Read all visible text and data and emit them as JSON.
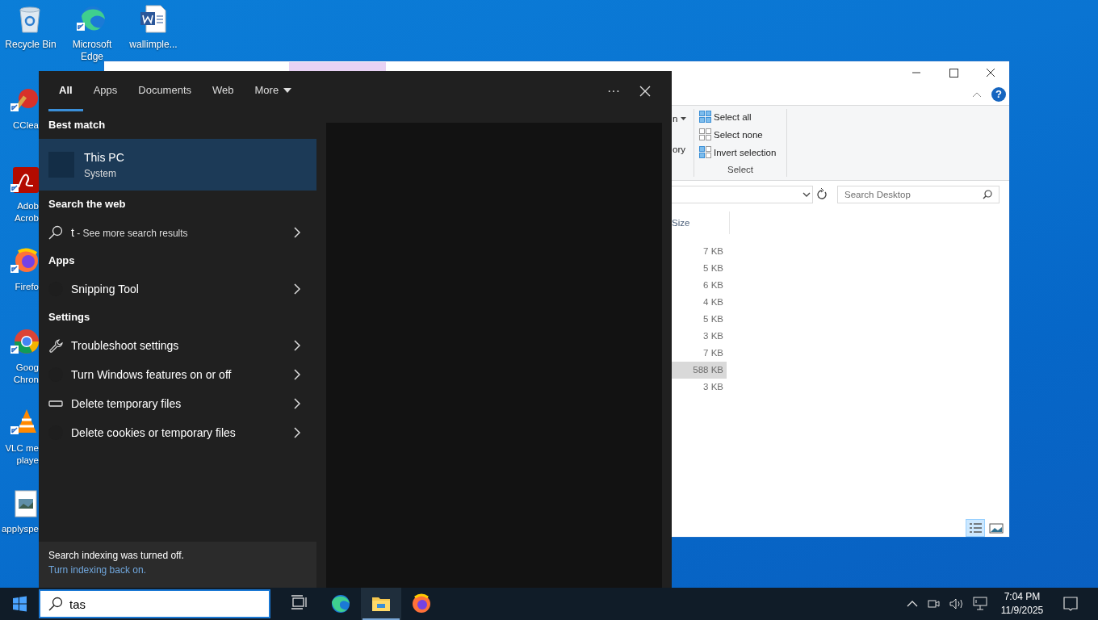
{
  "desktop": {
    "columns": [
      [
        {
          "label": "Recycle Bin",
          "kind": "recycle"
        },
        {
          "label": "CClea",
          "kind": "ccleaner"
        },
        {
          "label": "Adob Acrob",
          "kind": "acrobat"
        },
        {
          "label": "Firefo",
          "kind": "firefox"
        },
        {
          "label": "Goog Chron",
          "kind": "chrome"
        },
        {
          "label": "VLC me playe",
          "kind": "vlc"
        },
        {
          "label": "applyspe",
          "kind": "image"
        }
      ],
      [
        {
          "label": "Microsoft Edge",
          "kind": "edge"
        }
      ],
      [
        {
          "label": "wallimple...",
          "kind": "word"
        }
      ]
    ]
  },
  "explorer": {
    "help_button": "?",
    "ribbon_partial": [
      {
        "label": "n",
        "dropdown": true
      },
      {
        "label": "ory",
        "dropdown": false
      }
    ],
    "select_group": {
      "label": "Select",
      "items": [
        {
          "label": "Select all",
          "kind": "all"
        },
        {
          "label": "Select none",
          "kind": "none"
        },
        {
          "label": "Invert selection",
          "kind": "invert"
        }
      ]
    },
    "search": {
      "placeholder": "Search Desktop"
    },
    "columns": [
      "Size"
    ],
    "rows": [
      {
        "size": "7 KB",
        "selected": false
      },
      {
        "size": "5 KB",
        "selected": false
      },
      {
        "size": "6 KB",
        "selected": false
      },
      {
        "size": "4 KB",
        "selected": false
      },
      {
        "size": "5 KB",
        "selected": false
      },
      {
        "size": "3 KB",
        "selected": false
      },
      {
        "size": "7 KB",
        "selected": false
      },
      {
        "size": "588 KB",
        "selected": true
      },
      {
        "size": "3 KB",
        "selected": false
      }
    ],
    "views": [
      {
        "kind": "details",
        "selected": true
      },
      {
        "kind": "large",
        "selected": false
      }
    ]
  },
  "search_panel": {
    "tabs": [
      {
        "label": "All",
        "selected": true,
        "dropdown": false
      },
      {
        "label": "Apps",
        "selected": false,
        "dropdown": false
      },
      {
        "label": "Documents",
        "selected": false,
        "dropdown": false
      },
      {
        "label": "Web",
        "selected": false,
        "dropdown": false
      },
      {
        "label": "More",
        "selected": false,
        "dropdown": true
      }
    ],
    "more_button": "···",
    "sections": [
      {
        "heading": "Best match",
        "kind": "best",
        "items": [
          {
            "title": "This PC",
            "subtitle": "System",
            "selected": true
          }
        ]
      },
      {
        "heading": "Search the web",
        "kind": "list",
        "items": [
          {
            "title": "t",
            "detail": "- See more search results",
            "kind": "search",
            "selected": false
          }
        ]
      },
      {
        "heading": "Apps",
        "kind": "list",
        "items": [
          {
            "title": "Snipping Tool",
            "kind": "blank",
            "selected": false
          }
        ]
      },
      {
        "heading": "Settings",
        "kind": "list",
        "items": [
          {
            "title": "Troubleshoot settings",
            "kind": "wrench",
            "selected": false
          },
          {
            "title": "Turn Windows features on or off",
            "kind": "blank",
            "selected": false
          },
          {
            "title": "Delete temporary files",
            "kind": "drive",
            "selected": false
          },
          {
            "title": "Delete cookies or temporary files",
            "kind": "blank",
            "selected": false
          }
        ]
      }
    ],
    "footer": {
      "message": "Search indexing was turned off.",
      "link": "Turn indexing back on."
    }
  },
  "taskbar": {
    "search_value": "tas",
    "apps": [
      {
        "kind": "taskview",
        "active": false
      },
      {
        "kind": "edge",
        "active": false
      },
      {
        "kind": "explorer",
        "active": true
      },
      {
        "kind": "firefox",
        "active": false
      }
    ],
    "clock": {
      "time": "7:04 PM",
      "date": "11/9/2025"
    }
  }
}
